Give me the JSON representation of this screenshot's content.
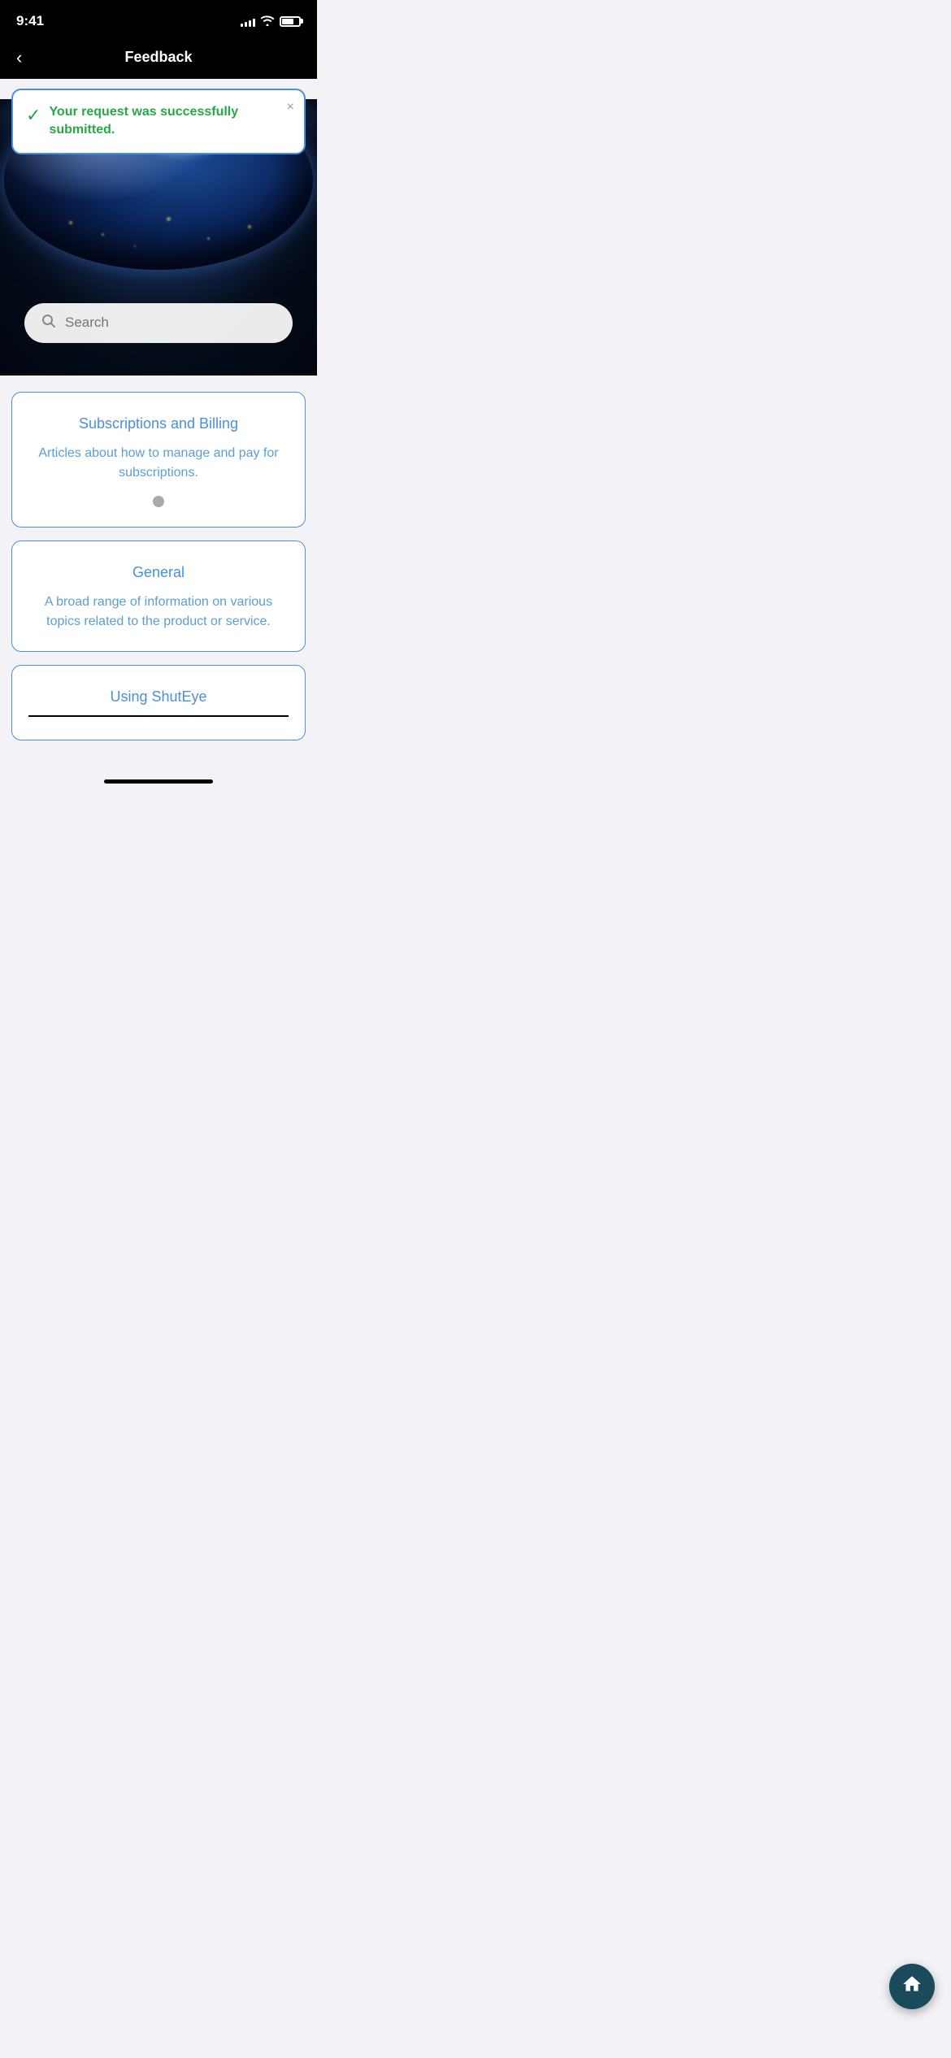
{
  "statusBar": {
    "time": "9:41",
    "signalBars": [
      4,
      6,
      8,
      10,
      12
    ],
    "batteryPercent": 70
  },
  "navBar": {
    "backLabel": "<",
    "title": "Feedback"
  },
  "successBanner": {
    "message": "Your request was successfully submitted.",
    "closeLabel": "×"
  },
  "search": {
    "placeholder": "Search"
  },
  "categories": [
    {
      "title": "Subscriptions and Billing",
      "description": "Articles about how to manage and pay for subscriptions.",
      "showDot": true
    },
    {
      "title": "General",
      "description": "A broad range of information on various topics related to the product or service.",
      "showDot": false
    }
  ],
  "partialCard": {
    "title": "Using ShutEye"
  },
  "homeFab": {
    "label": "⌂"
  }
}
